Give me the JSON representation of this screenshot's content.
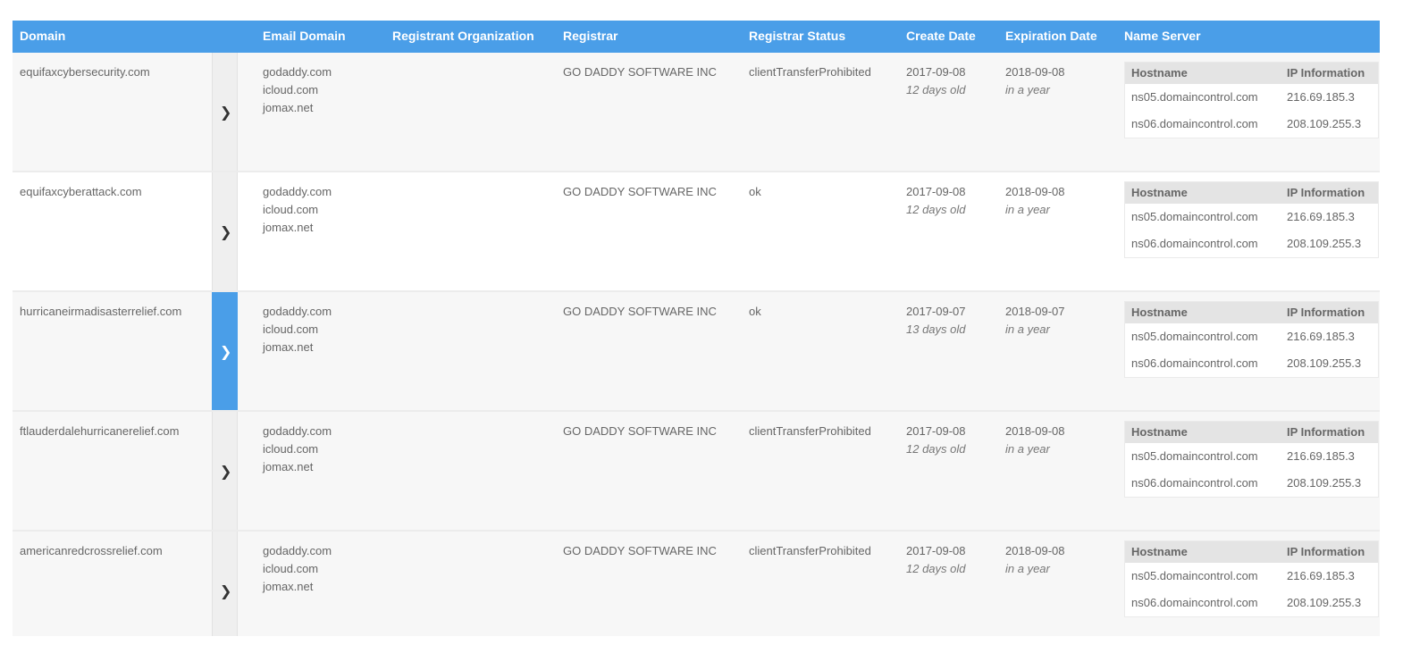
{
  "columns": {
    "domain": "Domain",
    "email_domain": "Email Domain",
    "registrant_org": "Registrant Organization",
    "registrar": "Registrar",
    "registrar_status": "Registrar Status",
    "create_date": "Create Date",
    "expiration_date": "Expiration Date",
    "name_server": "Name Server"
  },
  "name_server_columns": {
    "hostname": "Hostname",
    "ip": "IP Information"
  },
  "colors": {
    "header_bg": "#4a9ee8",
    "active_expander": "#4a9ee8"
  },
  "rows": [
    {
      "domain": "equifaxcybersecurity.com",
      "emails": [
        "godaddy.com",
        "icloud.com",
        "jomax.net"
      ],
      "registrant_org": "",
      "registrar": "GO DADDY SOFTWARE INC",
      "status": "clientTransferProhibited",
      "create_date": "2017-09-08",
      "create_age": "12 days old",
      "exp_date": "2018-09-08",
      "exp_rel": "in a year",
      "expander_icon": "chevron-right-icon",
      "name_servers": [
        {
          "host": "ns05.domaincontrol.com",
          "ip": "216.69.185.3"
        },
        {
          "host": "ns06.domaincontrol.com",
          "ip": "208.109.255.3"
        }
      ]
    },
    {
      "domain": "equifaxcyberattack.com",
      "emails": [
        "godaddy.com",
        "icloud.com",
        "jomax.net"
      ],
      "registrant_org": "",
      "registrar": "GO DADDY SOFTWARE INC",
      "status": "ok",
      "create_date": "2017-09-08",
      "create_age": "12 days old",
      "exp_date": "2018-09-08",
      "exp_rel": "in a year",
      "expander_icon": "chevron-right-icon",
      "name_servers": [
        {
          "host": "ns05.domaincontrol.com",
          "ip": "216.69.185.3"
        },
        {
          "host": "ns06.domaincontrol.com",
          "ip": "208.109.255.3"
        }
      ]
    },
    {
      "domain": "hurricaneirmadisasterrelief.com",
      "emails": [
        "godaddy.com",
        "icloud.com",
        "jomax.net"
      ],
      "registrant_org": "",
      "registrar": "GO DADDY SOFTWARE INC",
      "status": "ok",
      "create_date": "2017-09-07",
      "create_age": "13 days old",
      "exp_date": "2018-09-07",
      "exp_rel": "in a year",
      "expander_icon": "chevron-right-icon",
      "name_servers": [
        {
          "host": "ns05.domaincontrol.com",
          "ip": "216.69.185.3"
        },
        {
          "host": "ns06.domaincontrol.com",
          "ip": "208.109.255.3"
        }
      ]
    },
    {
      "domain": "ftlauderdalehurricanerelief.com",
      "emails": [
        "godaddy.com",
        "icloud.com",
        "jomax.net"
      ],
      "registrant_org": "",
      "registrar": "GO DADDY SOFTWARE INC",
      "status": "clientTransferProhibited",
      "create_date": "2017-09-08",
      "create_age": "12 days old",
      "exp_date": "2018-09-08",
      "exp_rel": "in a year",
      "expander_icon": "chevron-right-icon",
      "name_servers": [
        {
          "host": "ns05.domaincontrol.com",
          "ip": "216.69.185.3"
        },
        {
          "host": "ns06.domaincontrol.com",
          "ip": "208.109.255.3"
        }
      ]
    },
    {
      "domain": "americanredcrossrelief.com",
      "emails": [
        "godaddy.com",
        "icloud.com",
        "jomax.net"
      ],
      "registrant_org": "",
      "registrar": "GO DADDY SOFTWARE INC",
      "status": "clientTransferProhibited",
      "create_date": "2017-09-08",
      "create_age": "12 days old",
      "exp_date": "2018-09-08",
      "exp_rel": "in a year",
      "expander_icon": "chevron-right-icon",
      "name_servers": [
        {
          "host": "ns05.domaincontrol.com",
          "ip": "216.69.185.3"
        },
        {
          "host": "ns06.domaincontrol.com",
          "ip": "208.109.255.3"
        }
      ]
    }
  ]
}
